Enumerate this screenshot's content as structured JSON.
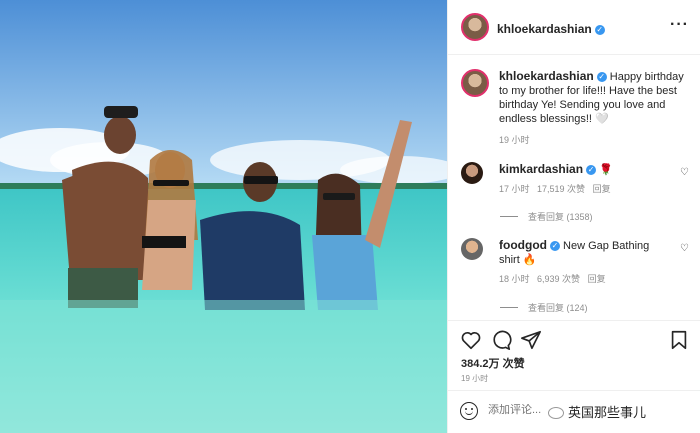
{
  "post": {
    "username": "khloekardashian",
    "caption": "Happy birthday to my brother for life!!! Have the best birthday Ye! Sending you love and endless blessings!! 🤍",
    "caption_time": "19 小时",
    "more_icon": "more-horizontal-icon"
  },
  "comments": [
    {
      "username": "kimkardashian",
      "text": "🌹",
      "time": "17 小时",
      "likes": "17,519 次赞",
      "reply": "回复",
      "view_replies": "查看回复 (1358)"
    },
    {
      "username": "foodgod",
      "text": "New Gap Bathing shirt 🔥",
      "time": "18 小时",
      "likes": "6,939 次赞",
      "reply": "回复",
      "view_replies": "查看回复 (124)"
    }
  ],
  "actions": {
    "like_count": "384.2万 次赞",
    "time": "19 小时",
    "icons": [
      "heart-icon",
      "comment-icon",
      "share-icon",
      "bookmark-icon"
    ]
  },
  "add_comment": {
    "placeholder": "添加评论..."
  },
  "watermark": "英国那些事儿",
  "colors": {
    "verified": "#3897f0",
    "sky": "#8fc6ee",
    "sea": "#4fd3cf",
    "muted": "#8e8e8e"
  }
}
